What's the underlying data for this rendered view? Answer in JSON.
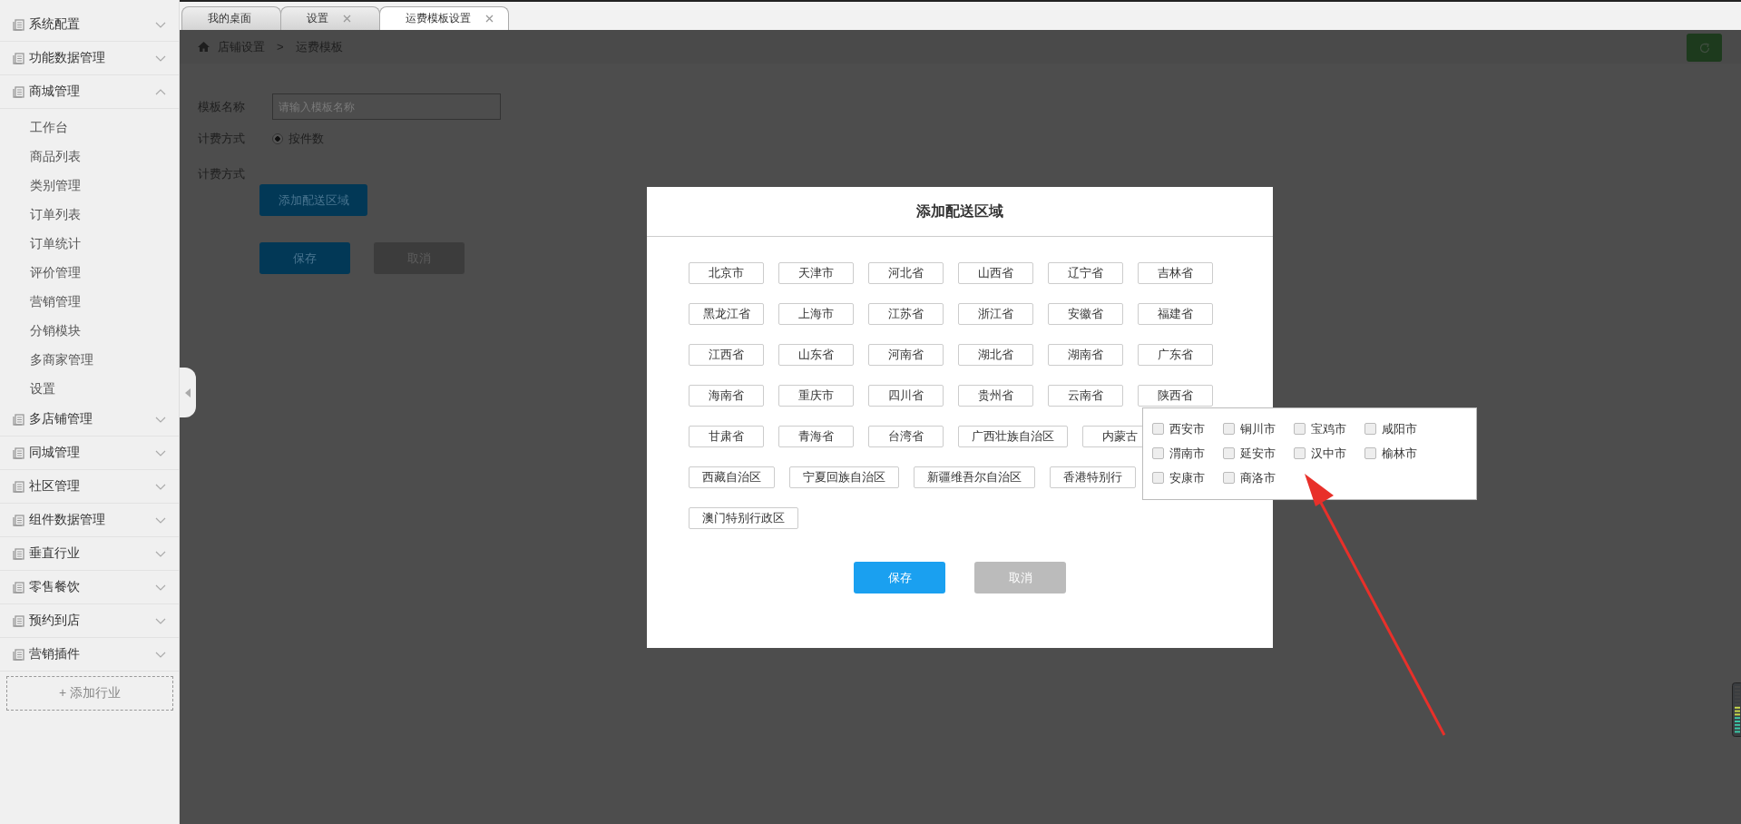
{
  "sidebar": {
    "sections": [
      {
        "label": "系统配置",
        "expanded": false
      },
      {
        "label": "功能数据管理",
        "expanded": false
      },
      {
        "label": "商城管理",
        "expanded": true,
        "children": [
          {
            "label": "工作台"
          },
          {
            "label": "商品列表"
          },
          {
            "label": "类别管理"
          },
          {
            "label": "订单列表"
          },
          {
            "label": "订单统计"
          },
          {
            "label": "评价管理"
          },
          {
            "label": "营销管理"
          },
          {
            "label": "分销模块"
          },
          {
            "label": "多商家管理"
          },
          {
            "label": "设置"
          }
        ]
      },
      {
        "label": "多店铺管理",
        "expanded": false
      },
      {
        "label": "同城管理",
        "expanded": false
      },
      {
        "label": "社区管理",
        "expanded": false
      },
      {
        "label": "组件数据管理",
        "expanded": false
      },
      {
        "label": "垂直行业",
        "expanded": false
      },
      {
        "label": "零售餐饮",
        "expanded": false
      },
      {
        "label": "预约到店",
        "expanded": false
      },
      {
        "label": "营销插件",
        "expanded": false
      }
    ],
    "add_button": "+ 添加行业"
  },
  "tabs": [
    {
      "label": "我的桌面",
      "selected": false,
      "closable": false
    },
    {
      "label": "设置",
      "selected": false,
      "closable": true
    },
    {
      "label": "运费模板设置",
      "selected": true,
      "closable": true
    }
  ],
  "breadcrumb": [
    "店铺设置",
    ">",
    "运费模板"
  ],
  "form": {
    "name_label": "模板名称",
    "name_placeholder": "请输入模板名称",
    "billing_label": "计费方式",
    "billing_option": {
      "label": "按件数",
      "selected": true
    },
    "area_label": "计费方式",
    "add_area_button": "添加配送区域",
    "save_button": "保存",
    "cancel_button": "取消"
  },
  "dialog": {
    "title": "添加配送区域",
    "regions": [
      {
        "label": "北京市"
      },
      {
        "label": "天津市"
      },
      {
        "label": "河北省"
      },
      {
        "label": "山西省"
      },
      {
        "label": "辽宁省"
      },
      {
        "label": "吉林省"
      },
      {
        "label": "黑龙江省"
      },
      {
        "label": "上海市"
      },
      {
        "label": "江苏省"
      },
      {
        "label": "浙江省"
      },
      {
        "label": "安徽省"
      },
      {
        "label": "福建省"
      },
      {
        "label": "江西省"
      },
      {
        "label": "山东省"
      },
      {
        "label": "河南省"
      },
      {
        "label": "湖北省"
      },
      {
        "label": "湖南省"
      },
      {
        "label": "广东省"
      },
      {
        "label": "海南省"
      },
      {
        "label": "重庆市"
      },
      {
        "label": "四川省"
      },
      {
        "label": "贵州省"
      },
      {
        "label": "云南省"
      },
      {
        "label": "陕西省"
      },
      {
        "label": "甘肃省"
      },
      {
        "label": "青海省"
      },
      {
        "label": "台湾省"
      },
      {
        "label": "广西壮族自治区"
      },
      {
        "label": "内蒙古"
      },
      {
        "label": "西藏自治区"
      },
      {
        "label": "宁夏回族自治区"
      },
      {
        "label": "新疆维吾尔自治区"
      },
      {
        "label": "香港特别行"
      },
      {
        "label": "澳门特别行政区"
      }
    ],
    "save_button": "保存",
    "cancel_button": "取消"
  },
  "city_popup": {
    "cities": [
      {
        "label": "西安市",
        "checked": false
      },
      {
        "label": "铜川市",
        "checked": false
      },
      {
        "label": "宝鸡市",
        "checked": false
      },
      {
        "label": "咸阳市",
        "checked": false
      },
      {
        "label": "渭南市",
        "checked": false
      },
      {
        "label": "延安市",
        "checked": false
      },
      {
        "label": "汉中市",
        "checked": false
      },
      {
        "label": "榆林市",
        "checked": false
      },
      {
        "label": "安康市",
        "checked": false
      },
      {
        "label": "商洛市",
        "checked": false
      }
    ]
  }
}
